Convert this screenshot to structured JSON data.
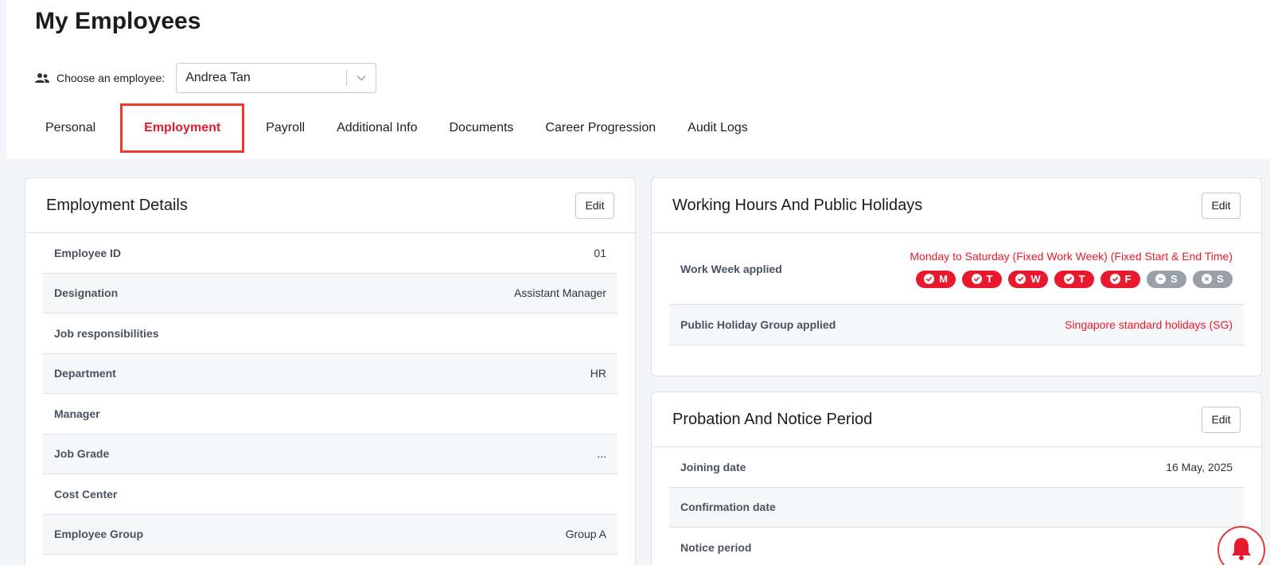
{
  "page": {
    "title": "My Employees"
  },
  "chooser": {
    "label": "Choose an employee:",
    "selected": "Andrea Tan",
    "icon": "users-icon"
  },
  "tabs": [
    {
      "label": "Personal",
      "active": false
    },
    {
      "label": "Employment",
      "active": true
    },
    {
      "label": "Payroll",
      "active": false
    },
    {
      "label": "Additional Info",
      "active": false
    },
    {
      "label": "Documents",
      "active": false
    },
    {
      "label": "Career Progression",
      "active": false
    },
    {
      "label": "Audit Logs",
      "active": false
    }
  ],
  "employment": {
    "title": "Employment Details",
    "edit_label": "Edit",
    "rows": [
      {
        "label": "Employee ID",
        "value": "01"
      },
      {
        "label": "Designation",
        "value": "Assistant Manager"
      },
      {
        "label": "Job responsibilities",
        "value": ""
      },
      {
        "label": "Department",
        "value": "HR"
      },
      {
        "label": "Manager",
        "value": ""
      },
      {
        "label": "Job Grade",
        "value": "..."
      },
      {
        "label": "Cost Center",
        "value": ""
      },
      {
        "label": "Employee Group",
        "value": "Group A"
      }
    ]
  },
  "working_hours": {
    "title": "Working Hours And Public Holidays",
    "edit_label": "Edit",
    "work_week_label": "Work Week applied",
    "work_week_value": "Monday to Saturday (Fixed Work Week) (Fixed Start & End Time)",
    "days": [
      {
        "letter": "M",
        "on": true
      },
      {
        "letter": "T",
        "on": true
      },
      {
        "letter": "W",
        "on": true
      },
      {
        "letter": "T",
        "on": true
      },
      {
        "letter": "F",
        "on": true
      },
      {
        "letter": "S",
        "on": false,
        "state": "half"
      },
      {
        "letter": "S",
        "on": false,
        "state": "off"
      }
    ],
    "holiday_label": "Public Holiday Group applied",
    "holiday_value": "Singapore standard holidays (SG)"
  },
  "probation": {
    "title": "Probation And Notice Period",
    "edit_label": "Edit",
    "rows": [
      {
        "label": "Joining date",
        "value": "16 May, 2025"
      },
      {
        "label": "Confirmation date",
        "value": ""
      },
      {
        "label": "Notice period",
        "value": ""
      }
    ]
  },
  "colors": {
    "accent": "#e8192c",
    "muted_chip": "#9aa0a8"
  }
}
